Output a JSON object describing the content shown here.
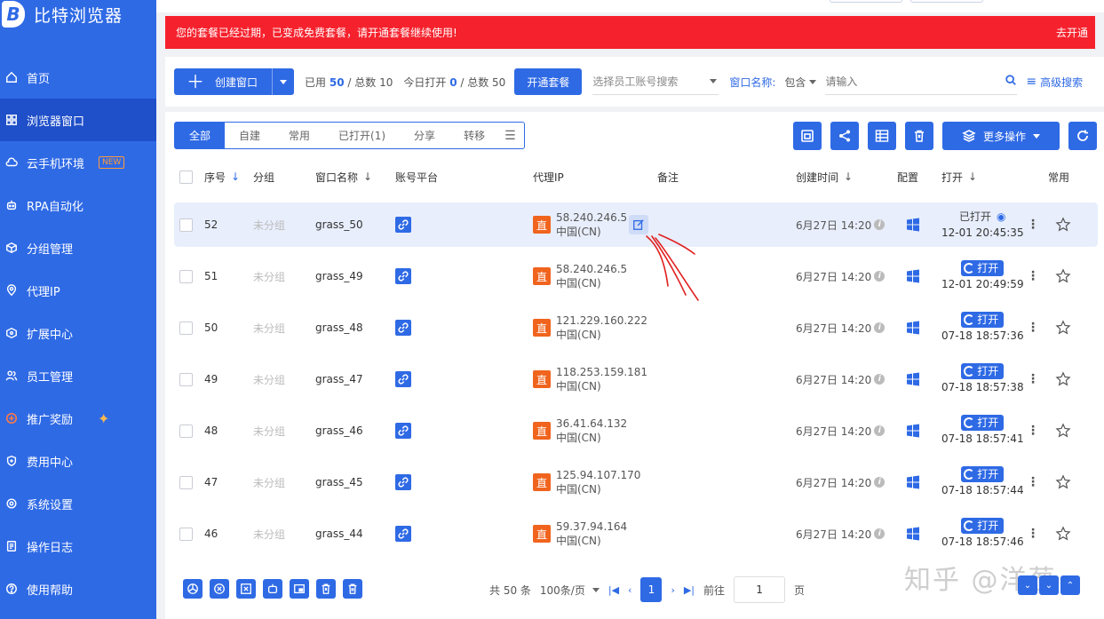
{
  "app": {
    "name": "比特浏览器",
    "logo_letter": "B"
  },
  "sidebar": {
    "items": [
      {
        "label": "首页",
        "icon": "home-icon"
      },
      {
        "label": "浏览器窗口",
        "icon": "grid-icon",
        "active": true
      },
      {
        "label": "云手机环境",
        "icon": "cloud-icon",
        "badge": "NEW"
      },
      {
        "label": "RPA自动化",
        "icon": "robot-icon"
      },
      {
        "label": "分组管理",
        "icon": "cube-icon"
      },
      {
        "label": "代理IP",
        "icon": "location-icon"
      },
      {
        "label": "扩展中心",
        "icon": "puzzle-icon"
      },
      {
        "label": "员工管理",
        "icon": "users-icon"
      },
      {
        "label": "推广奖励",
        "icon": "gift-icon",
        "sparkle": "✦"
      },
      {
        "label": "费用中心",
        "icon": "shield-icon"
      },
      {
        "label": "系统设置",
        "icon": "gear-icon"
      },
      {
        "label": "操作日志",
        "icon": "log-icon"
      },
      {
        "label": "使用帮助",
        "icon": "help-icon"
      }
    ]
  },
  "alert": {
    "message": "您的套餐已经过期，已变成免费套餐，请开通套餐继续使用!",
    "action": "去开通"
  },
  "toolbar": {
    "create_label": "创建窗口",
    "used_prefix": "已用",
    "used_value": "50",
    "used_suffix": "/ 总数 10",
    "opened_prefix": "今日打开",
    "opened_value": "0",
    "opened_suffix": "/ 总数 50",
    "plan_label": "开通套餐",
    "employee_placeholder": "选择员工账号搜索",
    "window_name_label": "窗口名称:",
    "match_mode": "包含",
    "search_placeholder": "请输入",
    "advanced_label": "高级搜索"
  },
  "tabs": {
    "items": [
      "全部",
      "自建",
      "常用",
      "已打开(1)",
      "分享",
      "转移"
    ],
    "active_index": 0
  },
  "actions": {
    "more_label": "更多操作"
  },
  "table": {
    "headers": {
      "seq": "序号",
      "group": "分组",
      "name": "窗口名称",
      "platform": "账号平台",
      "proxy": "代理IP",
      "remark": "备注",
      "created": "创建时间",
      "config": "配置",
      "open": "打开",
      "fav": "常用"
    },
    "open_label": "打开",
    "opened_label": "已打开",
    "rows": [
      {
        "seq": "52",
        "group": "未分组",
        "name": "grass_50",
        "ip": "58.240.246.5",
        "region": "中国(CN)",
        "created": "6月27日 14:20",
        "status": "opened",
        "time": "12-01 20:45:35"
      },
      {
        "seq": "51",
        "group": "未分组",
        "name": "grass_49",
        "ip": "58.240.246.5",
        "region": "中国(CN)",
        "created": "6月27日 14:20",
        "status": "open",
        "time": "12-01 20:49:59"
      },
      {
        "seq": "50",
        "group": "未分组",
        "name": "grass_48",
        "ip": "121.229.160.222",
        "region": "中国(CN)",
        "created": "6月27日 14:20",
        "status": "open",
        "time": "07-18 18:57:36"
      },
      {
        "seq": "49",
        "group": "未分组",
        "name": "grass_47",
        "ip": "118.253.159.181",
        "region": "中国(CN)",
        "created": "6月27日 14:20",
        "status": "open",
        "time": "07-18 18:57:38"
      },
      {
        "seq": "48",
        "group": "未分组",
        "name": "grass_46",
        "ip": "36.41.64.132",
        "region": "中国(CN)",
        "created": "6月27日 14:20",
        "status": "open",
        "time": "07-18 18:57:41"
      },
      {
        "seq": "47",
        "group": "未分组",
        "name": "grass_45",
        "ip": "125.94.107.170",
        "region": "中国(CN)",
        "created": "6月27日 14:20",
        "status": "open",
        "time": "07-18 18:57:44"
      },
      {
        "seq": "46",
        "group": "未分组",
        "name": "grass_44",
        "ip": "59.37.94.164",
        "region": "中国(CN)",
        "created": "6月27日 14:20",
        "status": "open",
        "time": "07-18 18:57:46"
      }
    ],
    "proxy_badge": "直"
  },
  "pagination": {
    "total": "共 50 条",
    "page_size": "100条/页",
    "current": "1",
    "goto_label": "前往",
    "goto_value": "1",
    "page_unit": "页"
  },
  "watermark": "知乎 @洋葱",
  "colors": {
    "primary": "#2f6ae5",
    "alert": "#f5222d",
    "proxy_badge": "#f0641e",
    "sidebar_active": "#1f4fc9"
  }
}
